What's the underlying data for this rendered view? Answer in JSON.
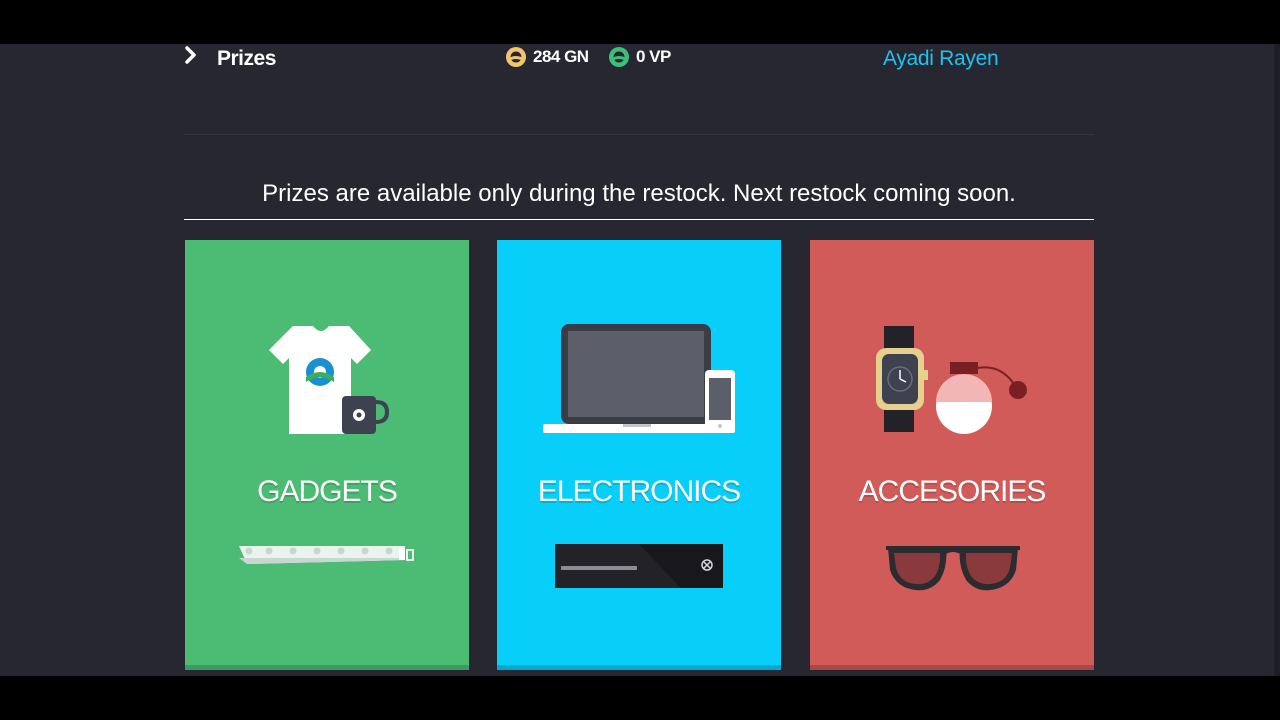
{
  "header": {
    "section_title": "Prizes",
    "gn_balance": "284 GN",
    "vp_balance": "0 VP",
    "username": "Ayadi Rayen"
  },
  "notice": "Prizes are available only during the restock. Next restock coming soon.",
  "categories": [
    {
      "label": "GADGETS",
      "color": "#4cbb74",
      "bar_color": "#3f9a60"
    },
    {
      "label": "ELECTRONICS",
      "color": "#08cefa",
      "bar_color": "#06a8cc"
    },
    {
      "label": "ACCESORIES",
      "color": "#d05b59",
      "bar_color": "#a94846"
    }
  ],
  "colors": {
    "background": "#262730",
    "username": "#1ec2ef",
    "gn_icon": "#f2c46d",
    "vp_icon": "#3dbf7a"
  }
}
